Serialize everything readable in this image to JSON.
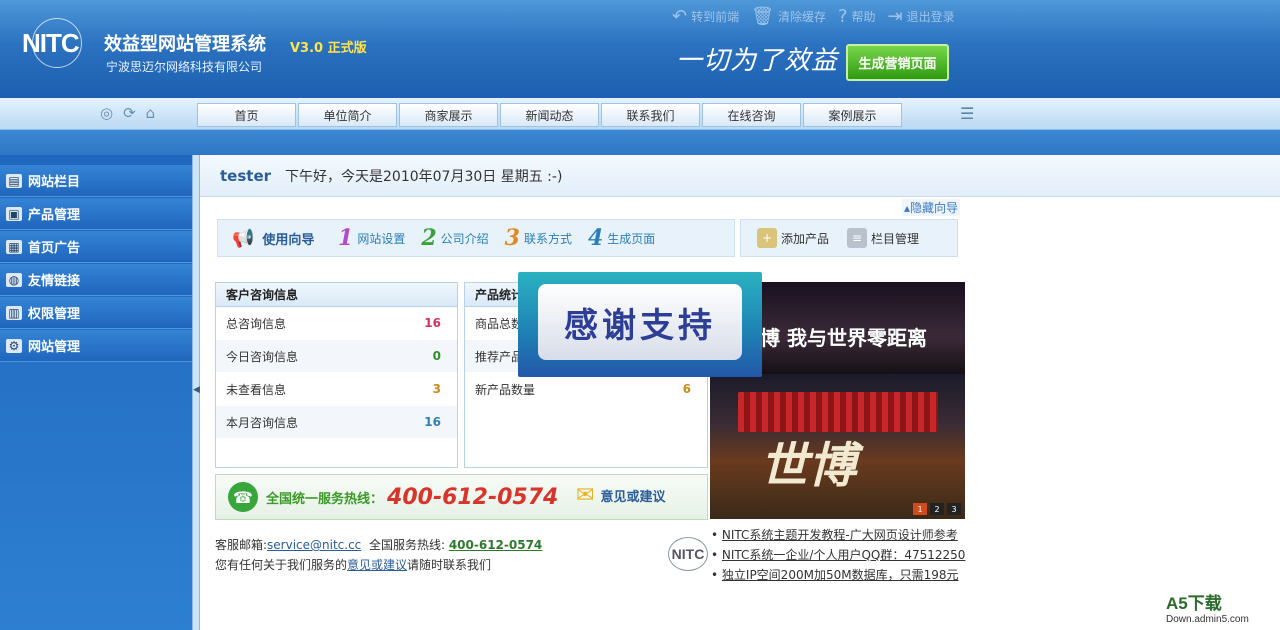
{
  "header": {
    "logo_text": "NITC",
    "title": "效益型网站管理系统",
    "version": "V3.0 正式版",
    "company": "宁波思迈尔网络科技有限公司",
    "slogan": "一切为了效益",
    "generate_button": "生成营销页面",
    "top_links": [
      {
        "label": "转到前端",
        "icon": "return-arrow-icon"
      },
      {
        "label": "清除缓存",
        "icon": "trash-icon"
      },
      {
        "label": "帮助",
        "icon": "help-icon"
      },
      {
        "label": "退出登录",
        "icon": "logout-icon"
      }
    ]
  },
  "nav": {
    "tabs": [
      "首页",
      "单位简介",
      "商家展示",
      "新闻动态",
      "联系我们",
      "在线咨询",
      "案例展示"
    ]
  },
  "sidebar": {
    "items": [
      {
        "label": "网站栏目",
        "icon": "folder-icon"
      },
      {
        "label": "产品管理",
        "icon": "product-icon"
      },
      {
        "label": "首页广告",
        "icon": "ad-icon"
      },
      {
        "label": "友情链接",
        "icon": "link-icon"
      },
      {
        "label": "权限管理",
        "icon": "permission-icon"
      },
      {
        "label": "网站管理",
        "icon": "settings-icon"
      }
    ]
  },
  "welcome": {
    "user": "tester",
    "greeting": "下午好，今天是2010年07月30日 星期五 :-)"
  },
  "guide": {
    "hide_label": "隐藏向导",
    "title": "使用向导",
    "steps": [
      {
        "num": "1",
        "label": "网站设置"
      },
      {
        "num": "2",
        "label": "公司介绍"
      },
      {
        "num": "3",
        "label": "联系方式"
      },
      {
        "num": "4",
        "label": "生成页面"
      }
    ],
    "quick": [
      {
        "label": "添加产品"
      },
      {
        "label": "栏目管理"
      }
    ]
  },
  "consult": {
    "title": "客户咨询信息",
    "rows": [
      {
        "label": "总咨询信息",
        "value": "16",
        "color": "#d0345a"
      },
      {
        "label": "今日咨询信息",
        "value": "0",
        "color": "#2f8f2f"
      },
      {
        "label": "未查看信息",
        "value": "3",
        "color": "#d08a1e"
      },
      {
        "label": "本月咨询信息",
        "value": "16",
        "color": "#2f7fb8"
      }
    ]
  },
  "product": {
    "title": "产品统计",
    "rows": [
      {
        "label": "商品总数",
        "value": ""
      },
      {
        "label": "推荐产品",
        "value": ""
      },
      {
        "label": "新产品数量",
        "value": "6",
        "color": "#d08a1e"
      }
    ]
  },
  "overlay": {
    "text": "感谢支持"
  },
  "banner": {
    "caption": "博  我与世界零距离",
    "big_text": "世博",
    "dots": [
      "1",
      "2",
      "3"
    ]
  },
  "hotline": {
    "label": "全国统一服务热线：",
    "number": "400-612-0574",
    "feedback": "意见或建议"
  },
  "contact": {
    "email_label": "客服邮箱:",
    "email": "service@nitc.cc",
    "hotline_label": "全国服务热线:",
    "hotline": "400-612-0574",
    "line2_pre": "您有任何关于我们服务的",
    "line2_link": "意见或建议",
    "line2_post": "请随时联系我们"
  },
  "news": [
    "NITC系统主题开发教程-广大网页设计师参考",
    "NITC系统一企业/个人用户QQ群：47512250",
    "独立IP空间200M加50M数据库，只需198元"
  ],
  "watermark": {
    "brand": "A5下载",
    "url": "Down.admin5.com"
  }
}
